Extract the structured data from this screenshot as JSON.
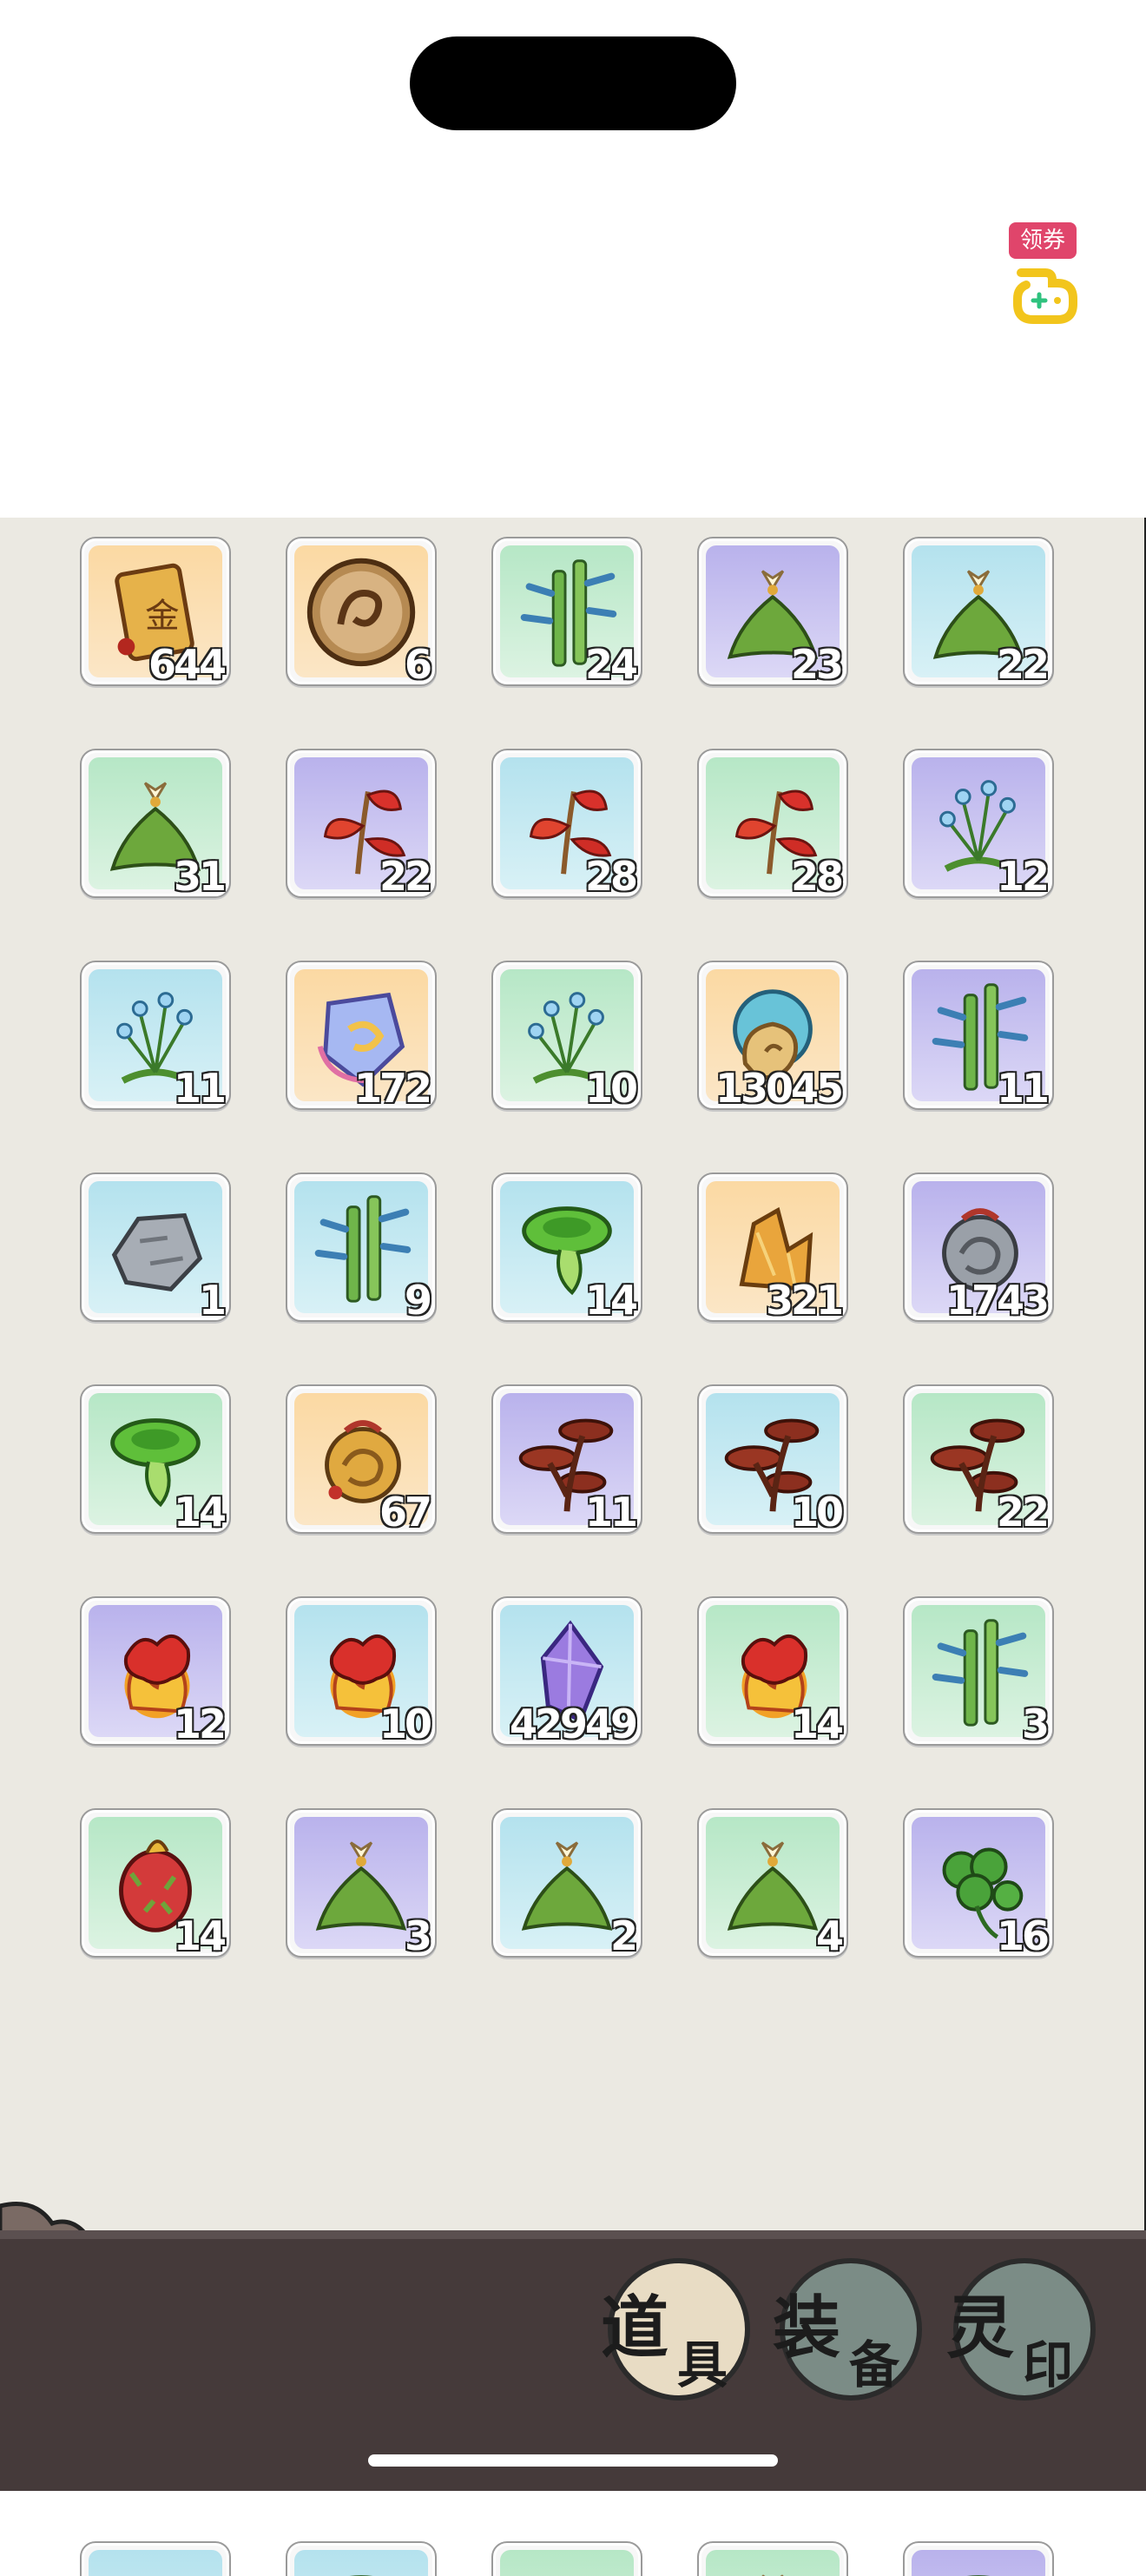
{
  "coupon": {
    "label": "领券",
    "icon": "game-controller-icon"
  },
  "inventory": {
    "items": [
      {
        "icon": "gold-token-icon",
        "bg": "orange",
        "qty": "644"
      },
      {
        "icon": "dragon-medallion-icon",
        "bg": "orange",
        "qty": "6"
      },
      {
        "icon": "bamboo-icon",
        "bg": "green",
        "qty": "24"
      },
      {
        "icon": "lily-bush-icon",
        "bg": "purple",
        "qty": "23"
      },
      {
        "icon": "lily-bush-icon",
        "bg": "blue",
        "qty": "22"
      },
      {
        "icon": "lily-bush-icon",
        "bg": "green",
        "qty": "31"
      },
      {
        "icon": "red-leaf-herb-icon",
        "bg": "purple",
        "qty": "22"
      },
      {
        "icon": "red-leaf-herb-icon",
        "bg": "blue",
        "qty": "28"
      },
      {
        "icon": "red-leaf-herb-icon",
        "bg": "green",
        "qty": "28"
      },
      {
        "icon": "blue-berry-plant-icon",
        "bg": "purple",
        "qty": "12"
      },
      {
        "icon": "blue-berry-plant-icon",
        "bg": "blue",
        "qty": "11"
      },
      {
        "icon": "spirit-crystal-icon",
        "bg": "orange",
        "qty": "172"
      },
      {
        "icon": "blue-berry-plant-icon",
        "bg": "green",
        "qty": "10"
      },
      {
        "icon": "spirit-orb-icon",
        "bg": "orange",
        "qty": "13045"
      },
      {
        "icon": "bamboo-icon",
        "bg": "purple",
        "qty": "11"
      },
      {
        "icon": "stone-icon",
        "bg": "blue",
        "qty": "1"
      },
      {
        "icon": "bamboo-icon",
        "bg": "blue",
        "qty": "9"
      },
      {
        "icon": "green-mushroom-icon",
        "bg": "blue",
        "qty": "14"
      },
      {
        "icon": "gold-ore-icon",
        "bg": "orange",
        "qty": "321"
      },
      {
        "icon": "silver-ornament-icon",
        "bg": "purple",
        "qty": "1743"
      },
      {
        "icon": "green-mushroom-icon",
        "bg": "green",
        "qty": "14"
      },
      {
        "icon": "gold-ornament-icon",
        "bg": "orange",
        "qty": "67"
      },
      {
        "icon": "lingzhi-icon",
        "bg": "purple",
        "qty": "11"
      },
      {
        "icon": "lingzhi-icon",
        "bg": "blue",
        "qty": "10"
      },
      {
        "icon": "lingzhi-icon",
        "bg": "green",
        "qty": "22"
      },
      {
        "icon": "fire-flower-icon",
        "bg": "purple",
        "qty": "12"
      },
      {
        "icon": "fire-flower-icon",
        "bg": "blue",
        "qty": "10"
      },
      {
        "icon": "purple-crystal-icon",
        "bg": "blue",
        "qty": "42949"
      },
      {
        "icon": "fire-flower-icon",
        "bg": "green",
        "qty": "14"
      },
      {
        "icon": "bamboo-icon",
        "bg": "green",
        "qty": "3"
      },
      {
        "icon": "dragon-fruit-icon",
        "bg": "green",
        "qty": "14"
      },
      {
        "icon": "lily-bush-icon",
        "bg": "purple",
        "qty": "3"
      },
      {
        "icon": "lily-bush-icon",
        "bg": "blue",
        "qty": "2"
      },
      {
        "icon": "lily-bush-icon",
        "bg": "green",
        "qty": "4"
      },
      {
        "icon": "clover-icon",
        "bg": "purple",
        "qty": "16"
      }
    ],
    "partial_row": [
      {
        "icon": "fire-flower-icon",
        "bg": "blue"
      },
      {
        "icon": "green-mushroom-icon",
        "bg": "blue"
      },
      {
        "icon": "red-leaf-herb-icon",
        "bg": "green"
      },
      {
        "icon": "lily-bush-icon",
        "bg": "green"
      },
      {
        "icon": "green-mushroom-icon",
        "bg": "purple"
      }
    ]
  },
  "bottom_bar": {
    "back_icon": "back-arrow-icon",
    "tabs": [
      {
        "c1": "道",
        "c2": "具",
        "active": true
      },
      {
        "c1": "装",
        "c2": "备",
        "active": false
      },
      {
        "c1": "灵",
        "c2": "印",
        "active": false
      }
    ]
  }
}
